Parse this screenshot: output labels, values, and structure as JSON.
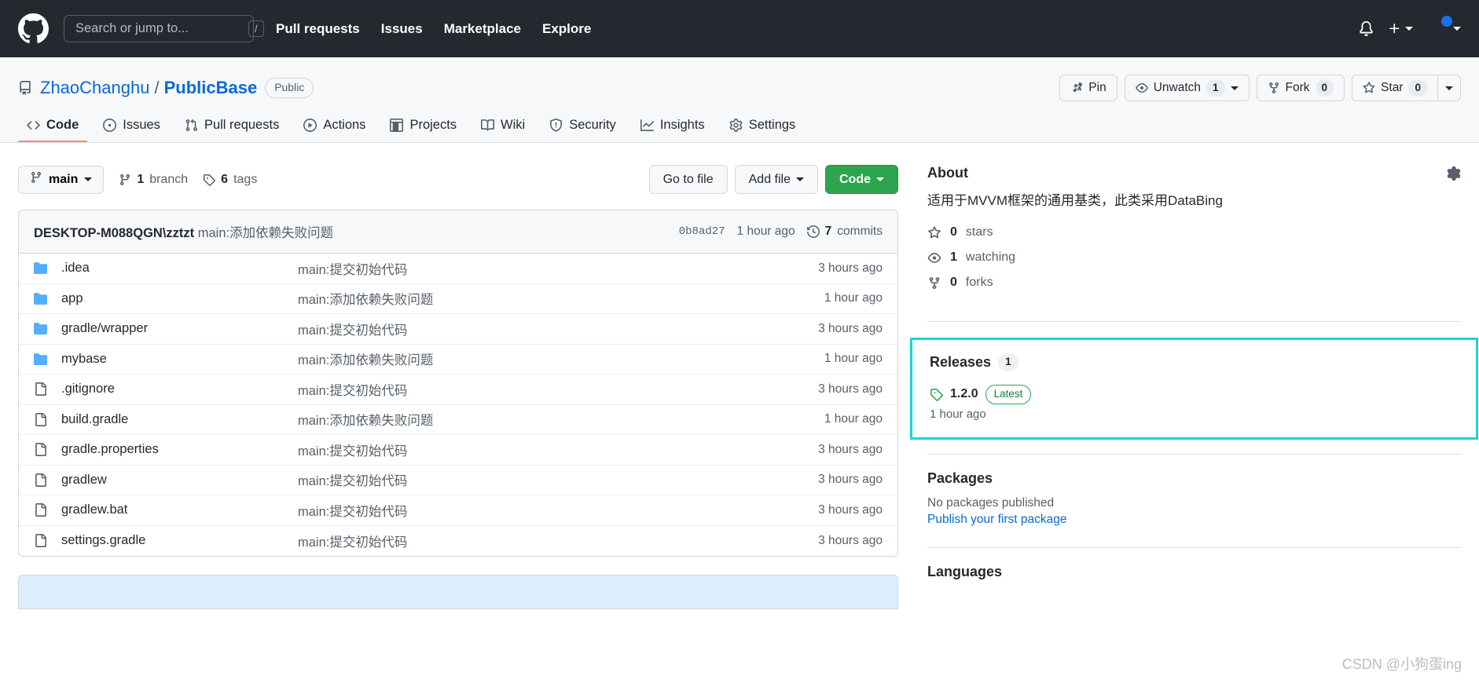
{
  "header": {
    "logo_icon": "github-mark-icon",
    "search": {
      "placeholder": "Search or jump to...",
      "value": "",
      "shortcut": "/"
    },
    "nav": [
      {
        "label": "Pull requests"
      },
      {
        "label": "Issues"
      },
      {
        "label": "Marketplace"
      },
      {
        "label": "Explore"
      }
    ],
    "notifications_icon": "bell-icon",
    "create_new_icon": "plus-icon",
    "account_icon": "avatar"
  },
  "repo": {
    "owner": "ZhaoChanghu",
    "separator": "/",
    "name": "PublicBase",
    "visibility": "Public",
    "actions": {
      "pin": "Pin",
      "unwatch": "Unwatch",
      "unwatch_count": "1",
      "fork": "Fork",
      "fork_count": "0",
      "star": "Star",
      "star_count": "0"
    },
    "tabs": [
      {
        "label": "Code",
        "icon": "code-icon",
        "active": true
      },
      {
        "label": "Issues",
        "icon": "issue-opened-icon",
        "active": false
      },
      {
        "label": "Pull requests",
        "icon": "git-pull-request-icon",
        "active": false
      },
      {
        "label": "Actions",
        "icon": "play-icon",
        "active": false
      },
      {
        "label": "Projects",
        "icon": "table-icon",
        "active": false
      },
      {
        "label": "Wiki",
        "icon": "book-icon",
        "active": false
      },
      {
        "label": "Security",
        "icon": "shield-icon",
        "active": false
      },
      {
        "label": "Insights",
        "icon": "graph-icon",
        "active": false
      },
      {
        "label": "Settings",
        "icon": "gear-icon",
        "active": false
      }
    ]
  },
  "toolbar": {
    "branch": "main",
    "branch_count": "1",
    "branch_label": "branch",
    "tag_count": "6",
    "tag_label": "tags",
    "go_to_file": "Go to file",
    "add_file": "Add file",
    "code": "Code"
  },
  "commit_bar": {
    "author": "DESKTOP-M088QGN\\zztzt",
    "message": "main:添加依赖失败问题",
    "sha": "0b8ad27",
    "time": "1 hour ago",
    "commits_count": "7",
    "commits_label": "commits"
  },
  "files": [
    {
      "type": "dir",
      "name": ".idea",
      "message": "main:提交初始代码",
      "time": "3 hours ago"
    },
    {
      "type": "dir",
      "name": "app",
      "message": "main:添加依赖失败问题",
      "time": "1 hour ago"
    },
    {
      "type": "dir",
      "name": "gradle/wrapper",
      "message": "main:提交初始代码",
      "time": "3 hours ago"
    },
    {
      "type": "dir",
      "name": "mybase",
      "message": "main:添加依赖失败问题",
      "time": "1 hour ago"
    },
    {
      "type": "file",
      "name": ".gitignore",
      "message": "main:提交初始代码",
      "time": "3 hours ago"
    },
    {
      "type": "file",
      "name": "build.gradle",
      "message": "main:添加依赖失败问题",
      "time": "1 hour ago"
    },
    {
      "type": "file",
      "name": "gradle.properties",
      "message": "main:提交初始代码",
      "time": "3 hours ago"
    },
    {
      "type": "file",
      "name": "gradlew",
      "message": "main:提交初始代码",
      "time": "3 hours ago"
    },
    {
      "type": "file",
      "name": "gradlew.bat",
      "message": "main:提交初始代码",
      "time": "3 hours ago"
    },
    {
      "type": "file",
      "name": "settings.gradle",
      "message": "main:提交初始代码",
      "time": "3 hours ago"
    }
  ],
  "sidebar": {
    "about": {
      "title": "About",
      "description": "适用于MVVM框架的通用基类，此类采用DataBing",
      "stats": [
        {
          "icon": "star-icon",
          "count": "0",
          "label": "stars"
        },
        {
          "icon": "eye-icon",
          "count": "1",
          "label": "watching"
        },
        {
          "icon": "fork-icon",
          "count": "0",
          "label": "forks"
        }
      ]
    },
    "releases": {
      "title": "Releases",
      "count": "1",
      "version": "1.2.0",
      "badge": "Latest",
      "time": "1 hour ago",
      "highlight_color": "#13d8d8"
    },
    "packages": {
      "title": "Packages",
      "empty_text": "No packages published",
      "link_text": "Publish your first package"
    },
    "languages": {
      "title": "Languages"
    }
  },
  "watermark": "CSDN @小狗蛋ing",
  "colors": {
    "accent": "#0969da",
    "green": "#2da44e",
    "tab_underline": "#fd8c73",
    "header_bg": "#24292f"
  }
}
